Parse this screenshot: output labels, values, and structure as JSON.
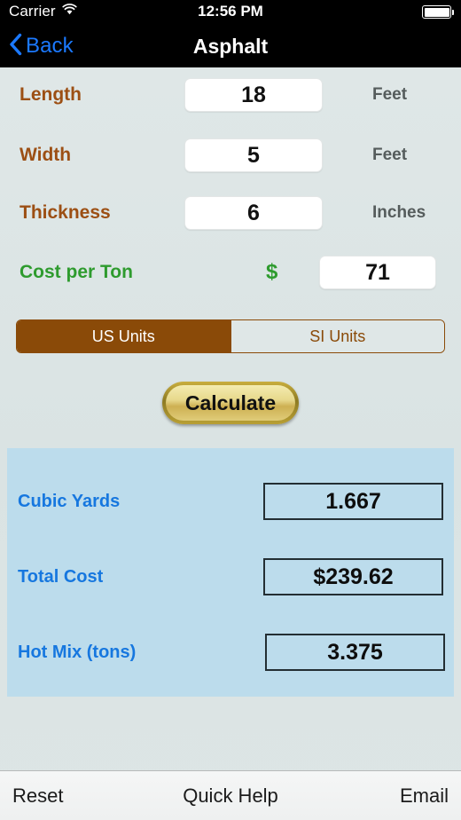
{
  "status_bar": {
    "carrier": "Carrier",
    "wifi_icon": "wifi-icon",
    "time": "12:56 PM",
    "battery_icon": "battery-icon"
  },
  "nav_bar": {
    "back_icon": "chevron-left-icon",
    "back_label": "Back",
    "title": "Asphalt"
  },
  "inputs": [
    {
      "label": "Length",
      "value": "18",
      "unit": "Feet"
    },
    {
      "label": "Width",
      "value": "5",
      "unit": "Feet"
    },
    {
      "label": "Thickness",
      "value": "6",
      "unit": "Inches"
    }
  ],
  "cost": {
    "label": "Cost per Ton",
    "currency_symbol": "$",
    "value": "71"
  },
  "units_selector": {
    "us_label": "US Units",
    "si_label": "SI Units",
    "selected": "US Units"
  },
  "calculate": {
    "label": "Calculate"
  },
  "results": [
    {
      "label": "Cubic Yards",
      "value": "1.667"
    },
    {
      "label": "Total Cost",
      "value": "$239.62"
    },
    {
      "label": "Hot Mix (tons)",
      "value": "3.375"
    }
  ],
  "toolbar": {
    "reset_label": "Reset",
    "help_label": "Quick Help",
    "email_label": "Email"
  },
  "colors": {
    "page_background": "#dee6e6",
    "nav_background": "#000000",
    "back_blue": "#1b79ff",
    "input_label_brown": "#9c4f14",
    "cost_green": "#2e9b2e",
    "segment_brown": "#8a4a08",
    "results_panel_blue": "#bcdcec",
    "result_label_blue": "#1677df",
    "calculate_gold": "#cdb052"
  }
}
